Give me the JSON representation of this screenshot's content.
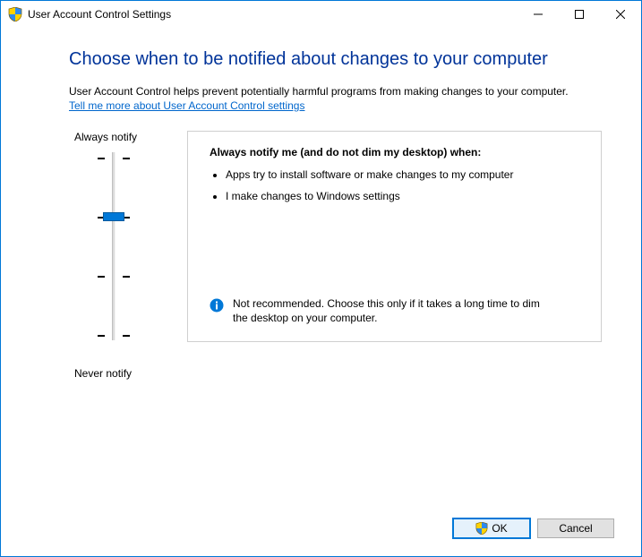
{
  "window": {
    "title": "User Account Control Settings"
  },
  "heading": "Choose when to be notified about changes to your computer",
  "description": "User Account Control helps prevent potentially harmful programs from making changes to your computer.",
  "help_link": "Tell me more about User Account Control settings",
  "slider": {
    "top_label": "Always notify",
    "bottom_label": "Never notify",
    "levels": 4,
    "selected_index": 1
  },
  "panel": {
    "title": "Always notify me (and do not dim my desktop) when:",
    "bullet1": "Apps try to install software or make changes to my computer",
    "bullet2": "I make changes to Windows settings",
    "recommendation": "Not recommended. Choose this only if it takes a long time to dim the desktop on your computer."
  },
  "buttons": {
    "ok": "OK",
    "cancel": "Cancel"
  }
}
